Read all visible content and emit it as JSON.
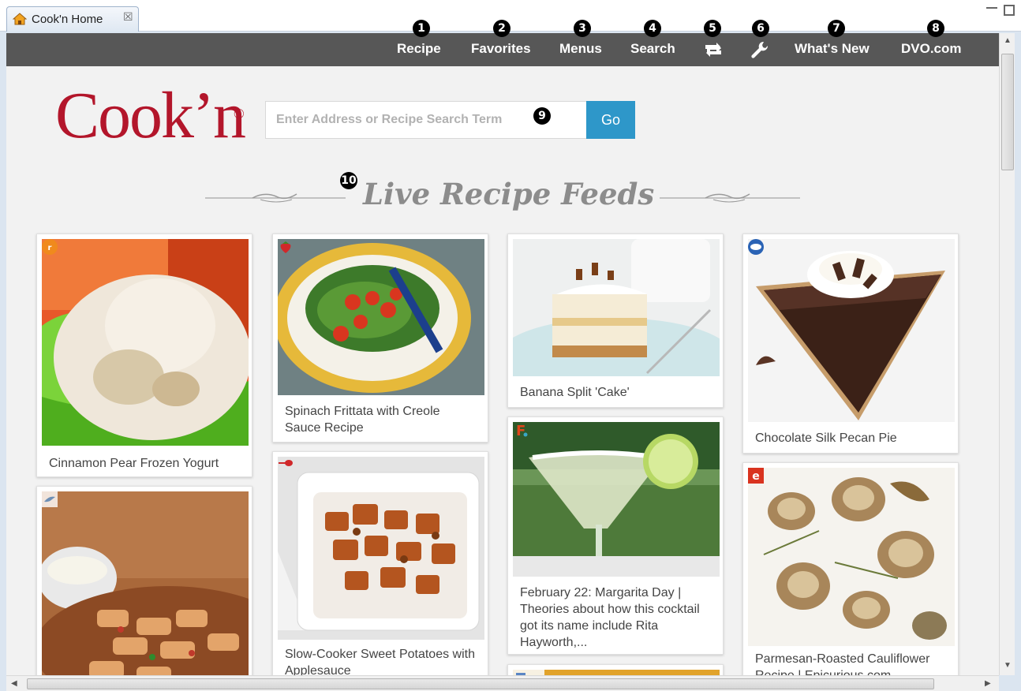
{
  "tab": {
    "title": "Cook'n Home",
    "close_glyph": "☒",
    "icon": "home-icon"
  },
  "nav": {
    "items": [
      {
        "label": "Recipe",
        "badge": "1"
      },
      {
        "label": "Favorites",
        "badge": "2"
      },
      {
        "label": "Menus",
        "badge": "3"
      },
      {
        "label": "Search",
        "badge": "4"
      },
      {
        "icon": "sync-icon",
        "badge": "5"
      },
      {
        "icon": "wrench-icon",
        "badge": "6"
      },
      {
        "label": "What's New",
        "badge": "7"
      },
      {
        "label": "DVO.com",
        "badge": "8"
      }
    ]
  },
  "logo": {
    "text": "Cook’n",
    "reg": "®"
  },
  "search": {
    "placeholder": "Enter Address or Recipe Search Term",
    "button": "Go",
    "badge": "9"
  },
  "feeds": {
    "title": "Live Recipe Feeds",
    "badge": "10"
  },
  "cards": [
    {
      "caption": "Cinnamon Pear Frozen Yogurt",
      "source_icon": "source-orange-logo-icon"
    },
    {
      "caption": "",
      "source_icon": "source-bird-logo-icon"
    },
    {
      "caption": "Spinach Frittata with Creole Sauce Recipe",
      "source_icon": "source-strawberry-icon"
    },
    {
      "caption": "Slow-Cooker Sweet Potatoes with Applesauce",
      "source_icon": "source-spoon-icon"
    },
    {
      "caption": "Banana Split 'Cake'",
      "source_icon": ""
    },
    {
      "caption": "February 22: Margarita Day | Theories about how this cocktail got its name include Rita Hayworth,...",
      "source_icon": "source-f-logo-icon"
    },
    {
      "caption": "",
      "source_icon": "source-blue-square-icon"
    },
    {
      "caption": "Chocolate Silk Pecan Pie",
      "source_icon": "source-pillsbury-icon"
    },
    {
      "caption": "Parmesan-Roasted Cauliflower Recipe | Epicurious.com",
      "source_icon": "source-e-logo-icon"
    }
  ],
  "colors": {
    "brand_red": "#b3162b",
    "nav_bg": "#575757",
    "go_blue": "#2e97c9",
    "heading_gray": "#8c8c8c"
  }
}
